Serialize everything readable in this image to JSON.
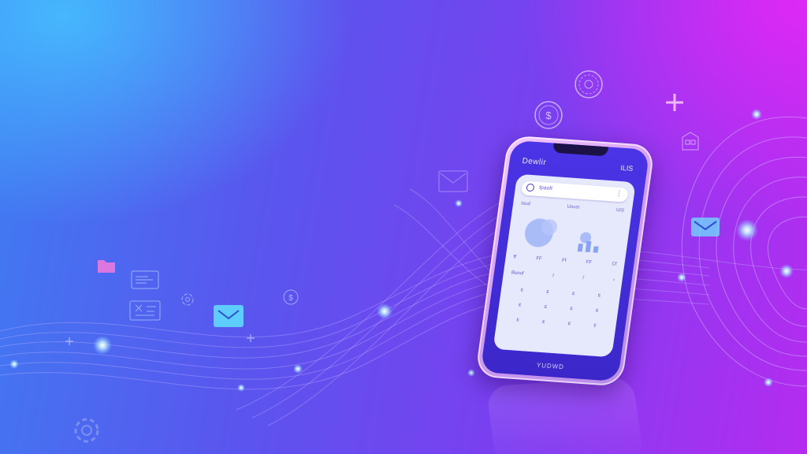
{
  "icons": [
    {
      "name": "folder-icon"
    },
    {
      "name": "document-icon"
    },
    {
      "name": "settings-icon"
    },
    {
      "name": "chat-icon"
    },
    {
      "name": "dollar-coin-icon"
    },
    {
      "name": "mail-icon"
    },
    {
      "name": "location-icon"
    },
    {
      "name": "store-icon"
    },
    {
      "name": "plus-icon"
    }
  ],
  "colors": {
    "bg_left": "#3f7cf2",
    "bg_right": "#b52cf0",
    "phone_frame": "#d7a1f3",
    "screen": "#4a34e6",
    "glow": "#9fd8ff"
  },
  "phone": {
    "app_title": "Dewlir",
    "status_text": "ILIS",
    "search_placeholder": "Ipaolt",
    "menu_glyph": "⋮",
    "labels": [
      "Ioud",
      "Uoust",
      "UIS"
    ],
    "ticks": [
      "ff",
      "FF",
      "Ff",
      "FF",
      "Cf"
    ],
    "row2": [
      "Bunuf",
      "/",
      "/",
      "›"
    ],
    "keypad": [
      "ɛ",
      "ɛ",
      "ɛ",
      "ɛ",
      "ɛ",
      "ɛ",
      "ɛ",
      "ɛ",
      "ɛ",
      "ɛ",
      "ɛ",
      "ɛ"
    ],
    "bottom_text": "YUDWD"
  }
}
